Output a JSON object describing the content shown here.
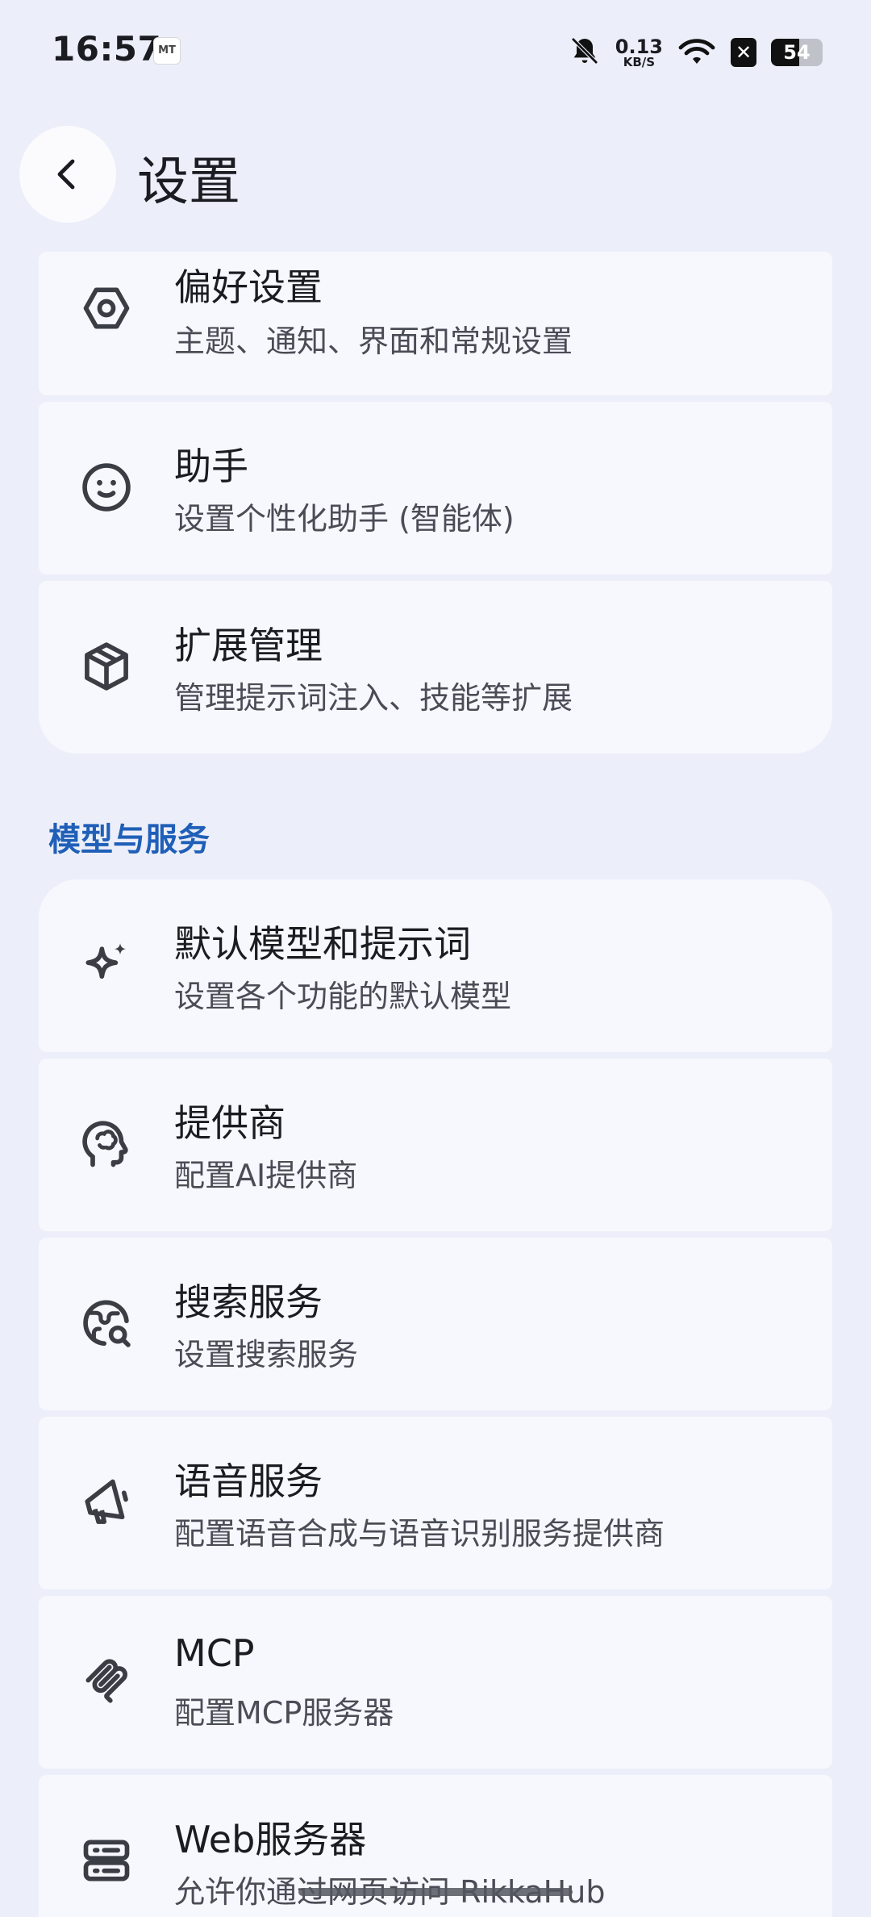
{
  "status_bar": {
    "time": "16:57",
    "app_icon_label": "MT",
    "net_speed_value": "0.13",
    "net_speed_unit": "KB/S",
    "x_badge": "✕",
    "battery_percent": "54",
    "battery_level": 0.54,
    "icons": [
      "mute-bell-icon",
      "wifi-icon",
      "x-badge-icon",
      "battery-icon"
    ]
  },
  "header": {
    "title": "设置",
    "back_icon": "chevron-left-icon"
  },
  "sections": [
    {
      "items": [
        {
          "title": "偏好设置",
          "subtitle": "主题、通知、界面和常规设置",
          "icon": "hexagon-settings-icon"
        },
        {
          "title": "助手",
          "subtitle": "设置个性化助手 (智能体)",
          "icon": "smiley-face-icon"
        },
        {
          "title": "扩展管理",
          "subtitle": "管理提示词注入、技能等扩展",
          "icon": "package-box-icon"
        }
      ]
    },
    {
      "header": "模型与服务",
      "items": [
        {
          "title": "默认模型和提示词",
          "subtitle": "设置各个功能的默认模型",
          "icon": "sparkles-icon"
        },
        {
          "title": "提供商",
          "subtitle": "配置AI提供商",
          "icon": "brain-head-icon"
        },
        {
          "title": "搜索服务",
          "subtitle": "设置搜索服务",
          "icon": "globe-search-icon"
        },
        {
          "title": "语音服务",
          "subtitle": "配置语音合成与语音识别服务提供商",
          "icon": "megaphone-icon"
        },
        {
          "title": "MCP",
          "subtitle": "配置MCP服务器",
          "icon": "mcp-icon"
        },
        {
          "title": "Web服务器",
          "subtitle": "允许你通过网页访问 RikkaHub",
          "icon": "server-icon"
        }
      ]
    }
  ],
  "colors": {
    "background": "#ECEFF9",
    "card": "#F7F8FD",
    "section_header": "#1F5FB8",
    "text_primary": "#1B1C22",
    "text_secondary": "#4A4C56",
    "icon": "#3B3D45"
  }
}
